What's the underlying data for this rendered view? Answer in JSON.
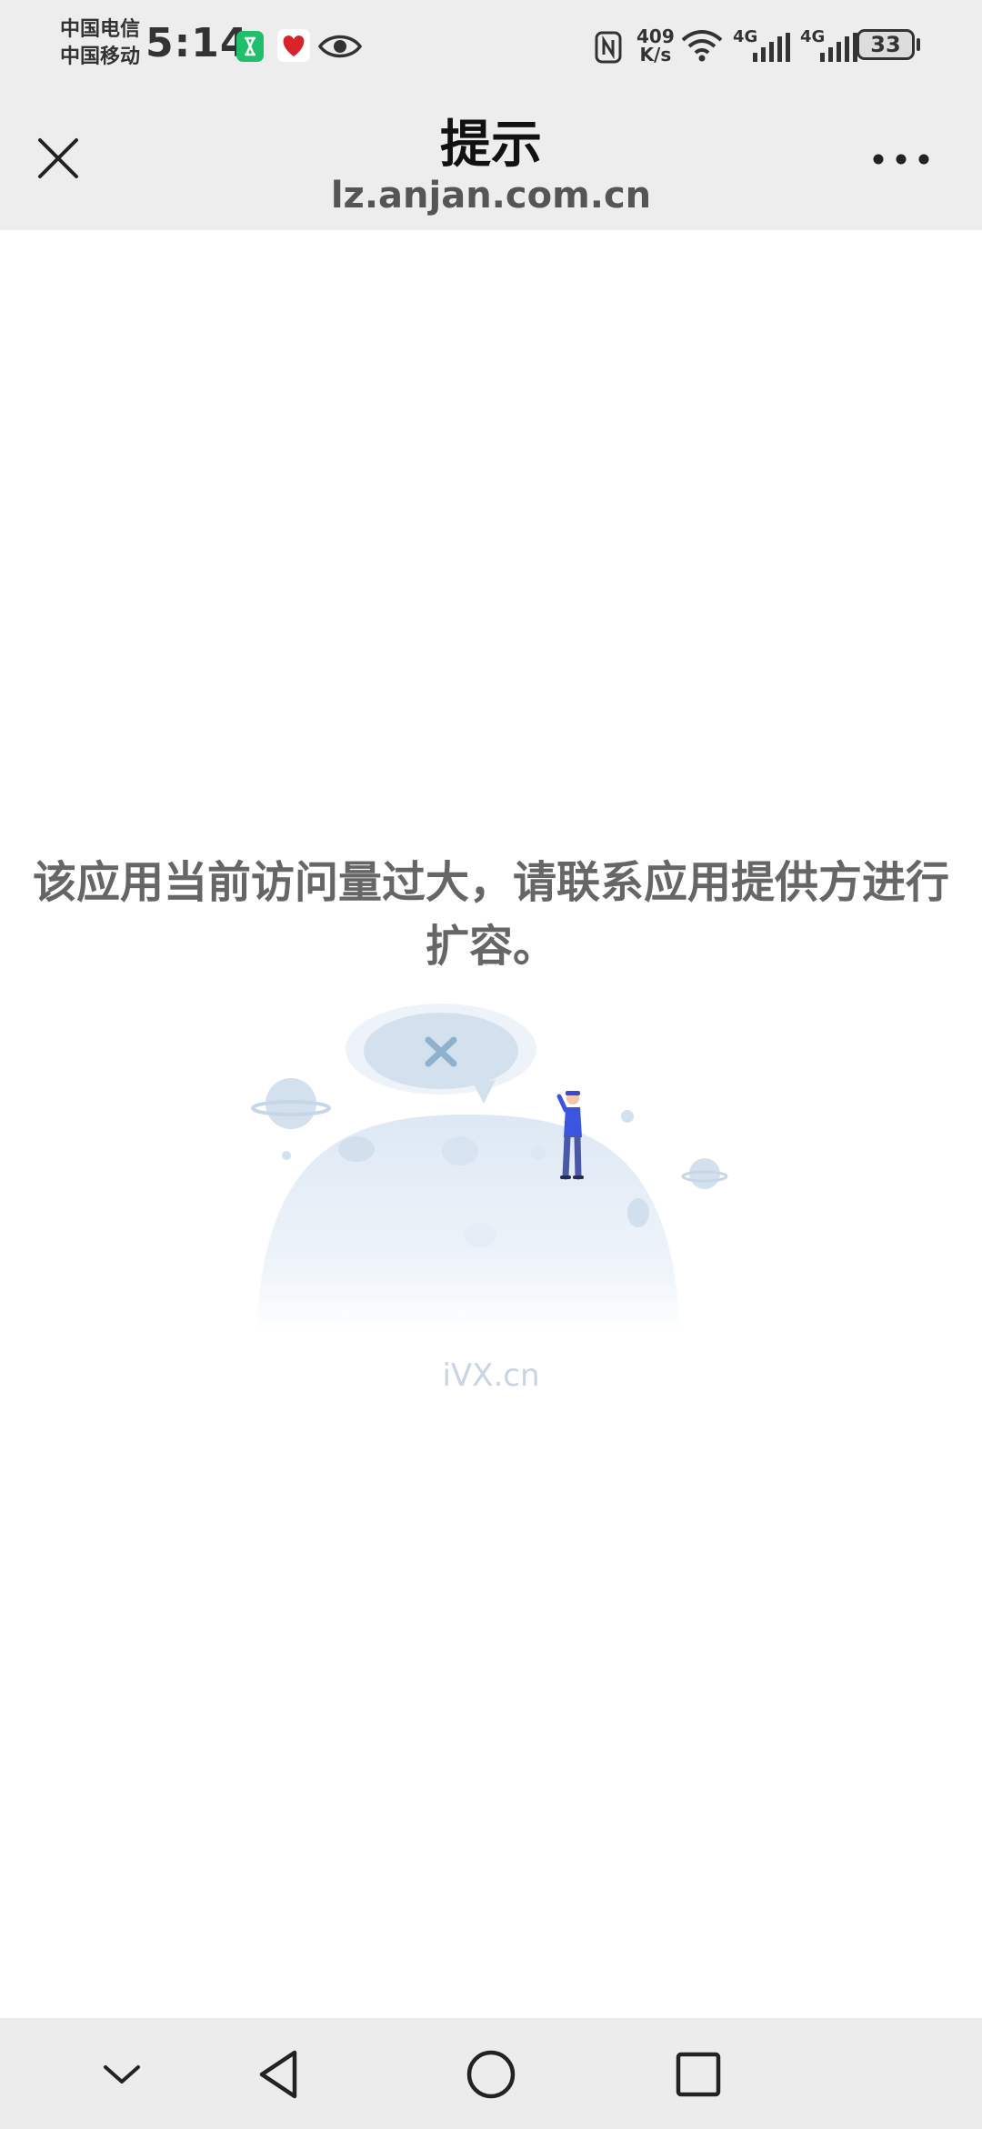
{
  "status_bar": {
    "carrier_1": "中国电信",
    "carrier_2": "中国移动",
    "time": "5:14",
    "speed_value": "409",
    "speed_unit": "K/s",
    "network_1": "4G",
    "network_2": "4G",
    "battery": "33",
    "icons": [
      "hourglass-app-icon",
      "heart-app-icon",
      "eye-icon",
      "nfc-icon",
      "wifi-icon",
      "signal-icon",
      "battery-icon"
    ]
  },
  "nav": {
    "title": "提示",
    "url": "lz.anjan.com.cn",
    "close_icon": "close-icon",
    "more_icon": "more-icon"
  },
  "content": {
    "message": "该应用当前访问量过大，请联系应用提供方进行扩容。",
    "brand": "iVX.cn"
  },
  "system_nav": {
    "icons": [
      "chevron-down-icon",
      "back-icon",
      "home-icon",
      "recents-icon"
    ]
  }
}
